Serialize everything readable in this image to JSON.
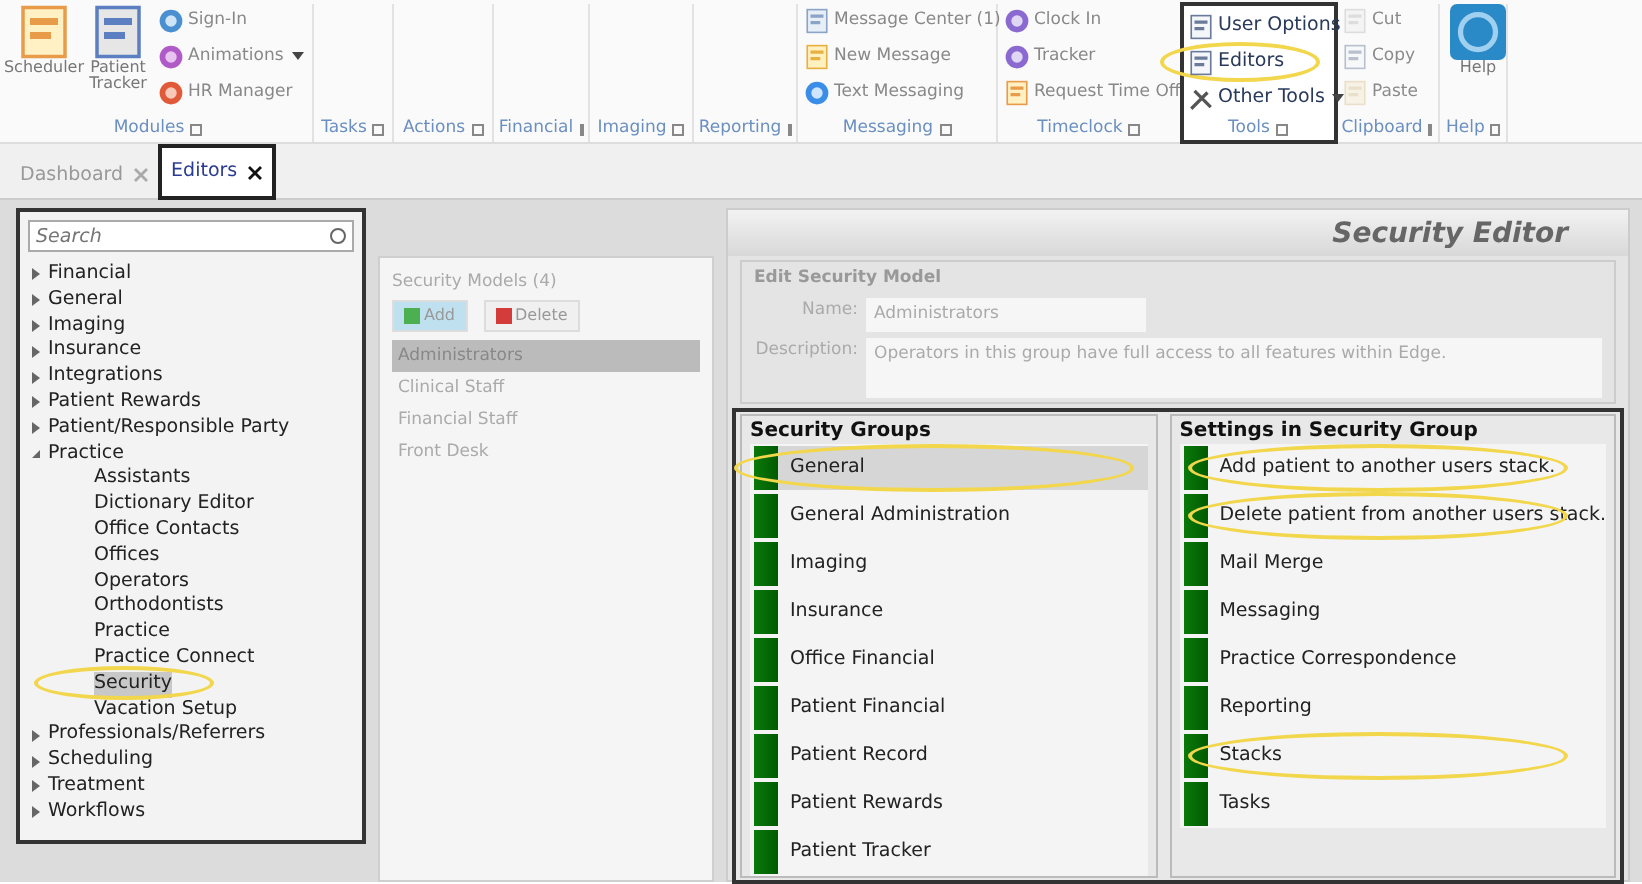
{
  "ribbon": {
    "groups": [
      {
        "label": "Modules",
        "framed": false,
        "large": [
          {
            "label": "Scheduler"
          },
          {
            "label": "Patient Tracker"
          }
        ],
        "small": [
          {
            "label": "Sign-In",
            "dropdown": false,
            "disabled": false
          },
          {
            "label": "Animations",
            "dropdown": true,
            "disabled": false
          },
          {
            "label": "HR Manager",
            "dropdown": false,
            "disabled": false
          }
        ]
      },
      {
        "label": "Tasks",
        "framed": false
      },
      {
        "label": "Actions",
        "framed": false
      },
      {
        "label": "Financial",
        "framed": false
      },
      {
        "label": "Imaging",
        "framed": false
      },
      {
        "label": "Reporting",
        "framed": false
      },
      {
        "label": "Messaging",
        "framed": false,
        "small": [
          {
            "label": "Message Center (1)",
            "dropdown": false,
            "disabled": false
          },
          {
            "label": "New Message",
            "dropdown": false,
            "disabled": false
          },
          {
            "label": "Text Messaging",
            "dropdown": false,
            "disabled": false
          }
        ]
      },
      {
        "label": "Timeclock",
        "framed": false,
        "small": [
          {
            "label": "Clock In",
            "dropdown": false,
            "disabled": false
          },
          {
            "label": "Tracker",
            "dropdown": false,
            "disabled": false
          },
          {
            "label": "Request Time Off",
            "dropdown": false,
            "disabled": false
          }
        ]
      },
      {
        "label": "Tools",
        "framed": true,
        "small": [
          {
            "label": "User Options",
            "dropdown": false,
            "disabled": false
          },
          {
            "label": "Editors",
            "dropdown": false,
            "disabled": false,
            "highlighted": true
          },
          {
            "label": "Other Tools",
            "dropdown": true,
            "disabled": false
          }
        ]
      },
      {
        "label": "Clipboard",
        "framed": false,
        "small": [
          {
            "label": "Cut",
            "dropdown": false,
            "disabled": true
          },
          {
            "label": "Copy",
            "dropdown": false,
            "disabled": true
          },
          {
            "label": "Paste",
            "dropdown": false,
            "disabled": true
          }
        ]
      },
      {
        "label": "Help",
        "framed": false,
        "large": [
          {
            "label": "Help"
          }
        ]
      }
    ]
  },
  "tabs": [
    {
      "label": "Dashboard",
      "selected": false,
      "framed": false
    },
    {
      "label": "Editors",
      "selected": true,
      "framed": true
    }
  ],
  "sidebar": {
    "framed": true,
    "search": {
      "placeholder": "Search"
    },
    "items": [
      {
        "label": "Financial",
        "expanded": false,
        "selected": false
      },
      {
        "label": "General",
        "expanded": false,
        "selected": false
      },
      {
        "label": "Imaging",
        "expanded": false,
        "selected": false
      },
      {
        "label": "Insurance",
        "expanded": false,
        "selected": false
      },
      {
        "label": "Integrations",
        "expanded": false,
        "selected": false
      },
      {
        "label": "Patient Rewards",
        "expanded": false,
        "selected": false
      },
      {
        "label": "Patient/Responsible Party",
        "expanded": false,
        "selected": false
      },
      {
        "label": "Practice",
        "expanded": true,
        "selected": false,
        "children": [
          {
            "label": "Assistants",
            "selected": false
          },
          {
            "label": "Dictionary Editor",
            "selected": false
          },
          {
            "label": "Office Contacts",
            "selected": false
          },
          {
            "label": "Offices",
            "selected": false
          },
          {
            "label": "Operators",
            "selected": false
          },
          {
            "label": "Orthodontists",
            "selected": false
          },
          {
            "label": "Practice",
            "selected": false
          },
          {
            "label": "Practice Connect",
            "selected": false
          },
          {
            "label": "Security",
            "selected": true,
            "highlighted": true
          },
          {
            "label": "Vacation Setup",
            "selected": false
          }
        ]
      },
      {
        "label": "Professionals/Referrers",
        "expanded": false,
        "selected": false
      },
      {
        "label": "Scheduling",
        "expanded": false,
        "selected": false
      },
      {
        "label": "Treatment",
        "expanded": false,
        "selected": false
      },
      {
        "label": "Workflows",
        "expanded": false,
        "selected": false
      }
    ]
  },
  "security_models": {
    "title": "Security Models (4)",
    "buttons": [
      {
        "label": "Add",
        "kind": "add"
      },
      {
        "label": "Delete",
        "kind": "delete"
      }
    ],
    "items": [
      {
        "label": "Administrators",
        "selected": true
      },
      {
        "label": "Clinical Staff",
        "selected": false
      },
      {
        "label": "Financial Staff",
        "selected": false
      },
      {
        "label": "Front Desk",
        "selected": false
      }
    ]
  },
  "editor": {
    "title": "Security Editor",
    "edit_model": {
      "title": "Edit Security Model",
      "name_label": "Name:",
      "name": "Administrators",
      "description_label": "Description:",
      "description": "Operators in this group have full access to all features within Edge."
    },
    "framed": true,
    "security_groups": {
      "title": "Security Groups",
      "items": [
        {
          "label": "General",
          "enabled": true,
          "selected": true,
          "highlighted": true
        },
        {
          "label": "General Administration",
          "enabled": true,
          "selected": false
        },
        {
          "label": "Imaging",
          "enabled": true,
          "selected": false
        },
        {
          "label": "Insurance",
          "enabled": true,
          "selected": false
        },
        {
          "label": "Office Financial",
          "enabled": true,
          "selected": false
        },
        {
          "label": "Patient Financial",
          "enabled": true,
          "selected": false
        },
        {
          "label": "Patient Record",
          "enabled": true,
          "selected": false
        },
        {
          "label": "Patient Rewards",
          "enabled": true,
          "selected": false
        },
        {
          "label": "Patient Tracker",
          "enabled": true,
          "selected": false
        }
      ]
    },
    "settings": {
      "title": "Settings in Security Group",
      "items": [
        {
          "label": "Add patient to another users stack.",
          "enabled": true,
          "highlighted": true
        },
        {
          "label": "Delete patient from another users stack.",
          "enabled": true,
          "highlighted": true
        },
        {
          "label": "Mail Merge",
          "enabled": true
        },
        {
          "label": "Messaging",
          "enabled": true
        },
        {
          "label": "Practice Correspondence",
          "enabled": true
        },
        {
          "label": "Reporting",
          "enabled": true
        },
        {
          "label": "Stacks",
          "enabled": true,
          "highlighted": true
        },
        {
          "label": "Tasks",
          "enabled": true
        }
      ]
    }
  }
}
